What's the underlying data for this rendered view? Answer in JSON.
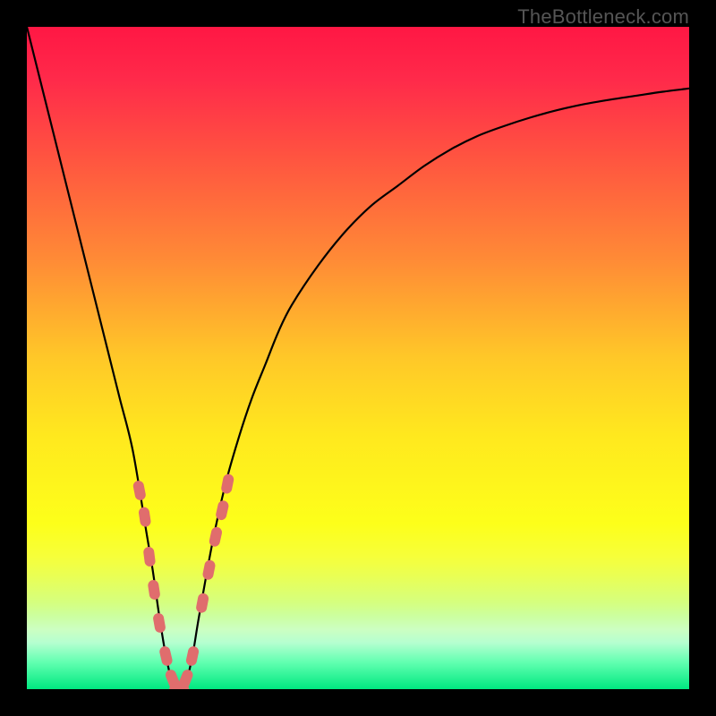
{
  "watermark": "TheBottleneck.com",
  "colors": {
    "background": "#000000",
    "curve": "#000000",
    "dots": "#e06d6d",
    "gradient_stops": [
      {
        "offset": 0.0,
        "color": "#ff1744"
      },
      {
        "offset": 0.08,
        "color": "#ff2a4a"
      },
      {
        "offset": 0.2,
        "color": "#ff5540"
      },
      {
        "offset": 0.35,
        "color": "#ff8a36"
      },
      {
        "offset": 0.5,
        "color": "#ffc828"
      },
      {
        "offset": 0.62,
        "color": "#ffe91e"
      },
      {
        "offset": 0.75,
        "color": "#fdff1a"
      },
      {
        "offset": 0.8,
        "color": "#f6ff3a"
      },
      {
        "offset": 0.83,
        "color": "#e9ff55"
      },
      {
        "offset": 0.85,
        "color": "#dfff6a"
      },
      {
        "offset": 0.87,
        "color": "#d5ff80"
      },
      {
        "offset": 0.89,
        "color": "#ccffa0"
      },
      {
        "offset": 0.91,
        "color": "#ccffc2"
      },
      {
        "offset": 0.93,
        "color": "#b5ffd0"
      },
      {
        "offset": 0.96,
        "color": "#60ffb0"
      },
      {
        "offset": 1.0,
        "color": "#00e880"
      }
    ]
  },
  "chart_data": {
    "type": "line",
    "title": "",
    "xlabel": "",
    "ylabel": "",
    "x_range": [
      0,
      100
    ],
    "y_range": [
      0,
      100
    ],
    "series": [
      {
        "name": "bottleneck-curve",
        "x": [
          0,
          2,
          4,
          6,
          8,
          10,
          12,
          14,
          16,
          18,
          19,
          20,
          21,
          22,
          23,
          24,
          25,
          26,
          28,
          30,
          32,
          34,
          36,
          38,
          40,
          44,
          48,
          52,
          56,
          60,
          64,
          68,
          72,
          76,
          80,
          84,
          88,
          92,
          96,
          100
        ],
        "y": [
          100,
          92,
          84,
          76,
          68,
          60,
          52,
          44,
          36,
          24,
          18,
          11,
          5,
          1,
          0,
          1,
          5,
          11,
          22,
          31,
          38,
          44,
          49,
          54,
          58,
          64,
          69,
          73,
          76,
          79,
          81.5,
          83.5,
          85,
          86.3,
          87.4,
          88.3,
          89,
          89.6,
          90.2,
          90.7
        ]
      }
    ],
    "highlight_points": {
      "name": "dot-cluster",
      "color": "#e06d6d",
      "x": [
        17.0,
        17.8,
        18.5,
        19.2,
        20.0,
        21.0,
        22.0,
        23.0,
        24.0,
        25.0,
        26.5,
        27.5,
        28.5,
        29.5,
        30.3
      ],
      "y": [
        30.0,
        26.0,
        20.0,
        15.0,
        10.0,
        5.0,
        1.5,
        0.0,
        1.5,
        5.0,
        13.0,
        18.0,
        23.0,
        27.0,
        31.0
      ]
    }
  }
}
